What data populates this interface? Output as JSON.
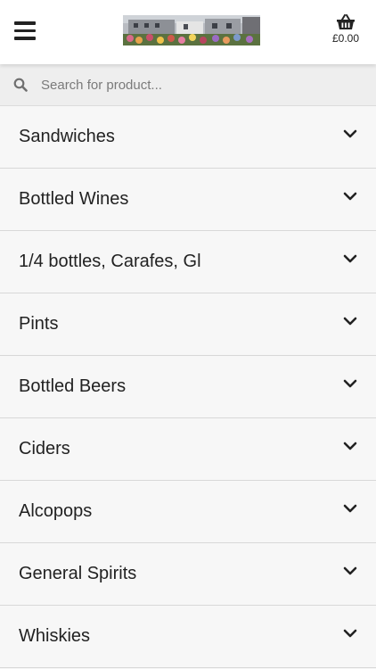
{
  "header": {
    "menu_icon": "hamburger-menu-icon",
    "logo_icon": "venue-photo-logo",
    "cart_icon": "shopping-basket-icon",
    "cart_total": "£0.00"
  },
  "search": {
    "icon": "search-icon",
    "placeholder": "Search for product..."
  },
  "categories": [
    {
      "label": "Sandwiches"
    },
    {
      "label": "Bottled Wines"
    },
    {
      "label": "1/4 bottles, Carafes, Gl"
    },
    {
      "label": "Pints"
    },
    {
      "label": "Bottled Beers"
    },
    {
      "label": "Ciders"
    },
    {
      "label": "Alcopops"
    },
    {
      "label": "General Spirits"
    },
    {
      "label": "Whiskies"
    }
  ],
  "category_icon": "chevron-down-icon"
}
